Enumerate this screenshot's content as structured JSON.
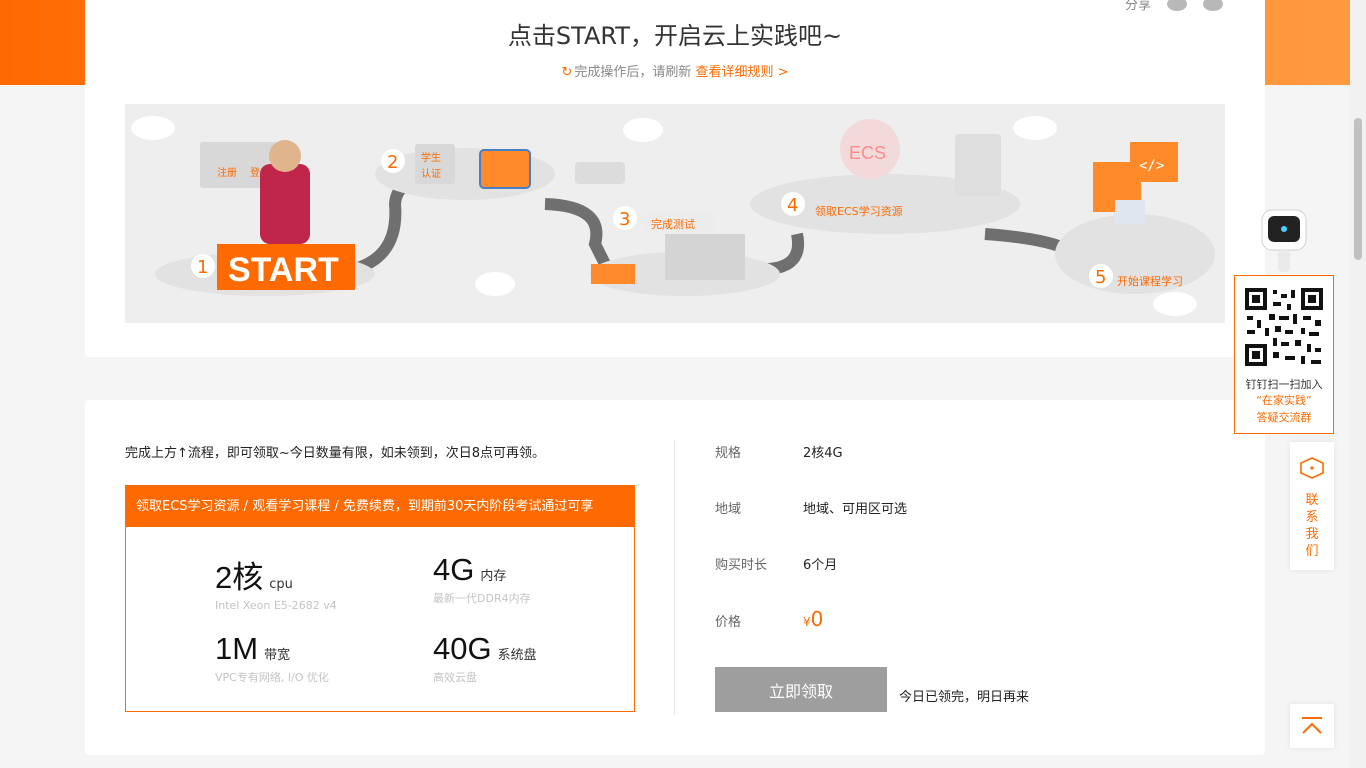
{
  "header": {
    "share_label": "分享",
    "share_icons": [
      "weibo-icon",
      "wechat-icon"
    ],
    "title": "点击START，开启云上实践吧~",
    "subtitle": "完成操作后，请刷新",
    "rules_link": "查看详细规则 >"
  },
  "banner": {
    "steps": [
      {
        "num": "1",
        "label": "START"
      },
      {
        "num": "2",
        "label": "学生认证"
      },
      {
        "num": "3",
        "label": "完成测试"
      },
      {
        "num": "4",
        "label": "领取ECS学习资源"
      },
      {
        "num": "5",
        "label": "开始课程学习"
      }
    ],
    "screen_register": "注册",
    "screen_login": "登录",
    "ecs_sign": "ECS",
    "student_sign_1": "学生",
    "student_sign_2": "认证",
    "code_sign": "</>"
  },
  "offer": {
    "intro": "完成上方↑流程，即可领取~今日数量有限，如未领到，次日8点可再领。",
    "headline": "领取ECS学习资源 / 观看学习课程 / 免费续费，到期前30天内阶段考试通过可享",
    "specs": [
      {
        "big": "2核",
        "unit": "cpu",
        "desc": "Intel Xeon E5-2682 v4"
      },
      {
        "big": "4G",
        "unit": "内存",
        "desc": "最新一代DDR4内存"
      },
      {
        "big": "1M",
        "unit": "带宽",
        "desc": "VPC专有网络, I/O 优化"
      },
      {
        "big": "40G",
        "unit": "系统盘",
        "desc": "高效云盘"
      }
    ]
  },
  "details": {
    "rows": [
      {
        "key": "规格",
        "value": "2核4G"
      },
      {
        "key": "地域",
        "value": "地域、可用区可选"
      },
      {
        "key": "购买时长",
        "value": "6个月"
      }
    ],
    "price_key": "价格",
    "price_currency": "¥",
    "price_value": "0",
    "claim_button": "立即领取",
    "claim_note": "今日已领完，明日再来"
  },
  "sidebar": {
    "qr_line1": "钉钉扫一扫加入",
    "qr_line2": "“在家实践”",
    "qr_line3": "答疑交流群",
    "contact_label": "联系我们"
  },
  "colors": {
    "accent": "#ff6a00",
    "disabled_button": "#9e9e9e"
  }
}
